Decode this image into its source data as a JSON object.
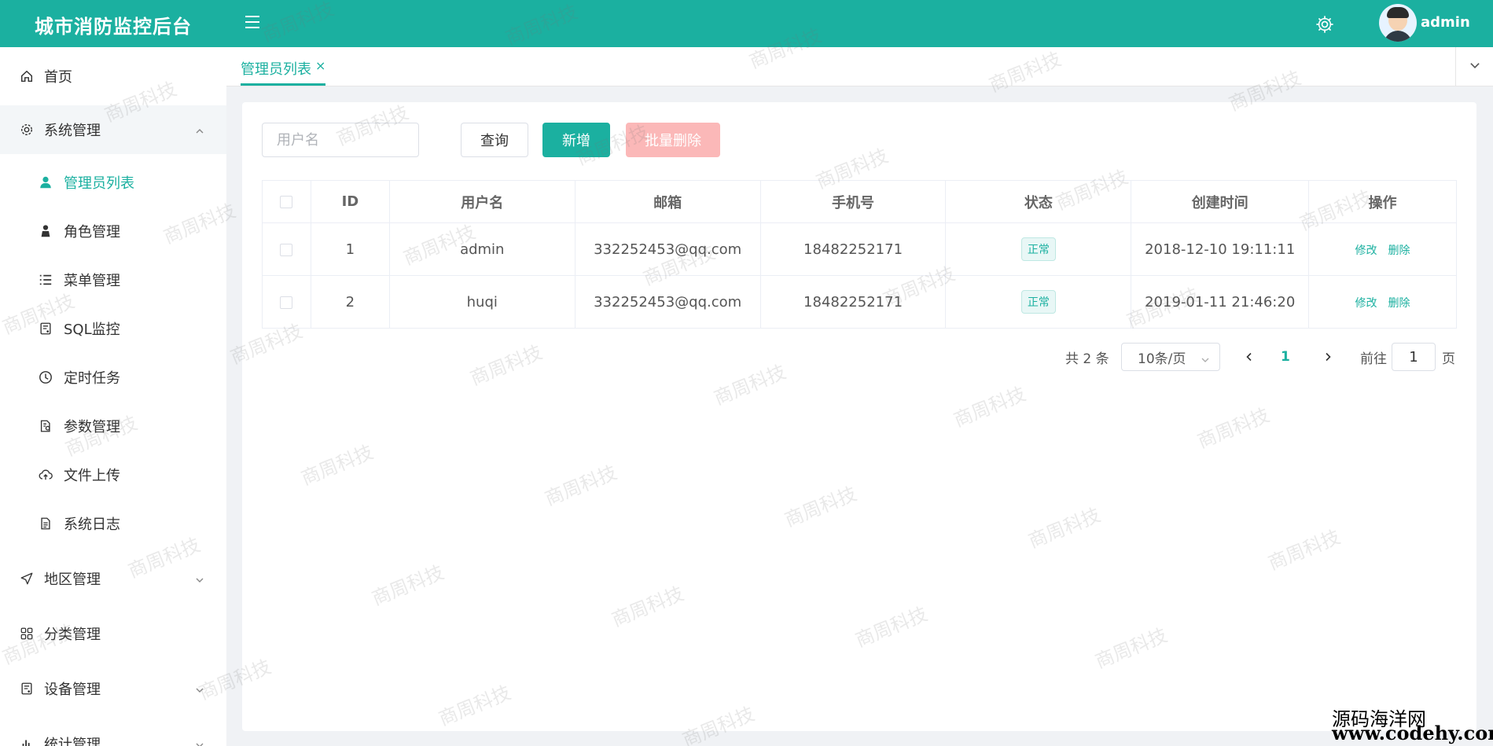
{
  "app": {
    "title": "城市消防监控后台",
    "username": "admin"
  },
  "colors": {
    "primary": "#1bb0a0",
    "danger_light": "#fbb8b8"
  },
  "sidebar": {
    "items": [
      {
        "label": "首页",
        "icon": "home-icon"
      },
      {
        "label": "系统管理",
        "icon": "gear-icon",
        "expanded": true
      },
      {
        "label": "管理员列表",
        "icon": "user-icon",
        "active": true
      },
      {
        "label": "角色管理",
        "icon": "role-icon"
      },
      {
        "label": "菜单管理",
        "icon": "list-icon"
      },
      {
        "label": "SQL监控",
        "icon": "database-icon"
      },
      {
        "label": "定时任务",
        "icon": "clock-icon"
      },
      {
        "label": "参数管理",
        "icon": "settings-doc-icon"
      },
      {
        "label": "文件上传",
        "icon": "cloud-upload-icon"
      },
      {
        "label": "系统日志",
        "icon": "document-icon"
      },
      {
        "label": "地区管理",
        "icon": "location-icon"
      },
      {
        "label": "分类管理",
        "icon": "grid-icon"
      },
      {
        "label": "设备管理",
        "icon": "device-icon"
      },
      {
        "label": "统计管理",
        "icon": "chart-icon"
      }
    ]
  },
  "tabs": [
    {
      "label": "管理员列表",
      "close": "×"
    }
  ],
  "toolbar": {
    "search_placeholder": "用户名",
    "query_label": "查询",
    "add_label": "新增",
    "batch_delete_label": "批量删除"
  },
  "table": {
    "headers": [
      "ID",
      "用户名",
      "邮箱",
      "手机号",
      "状态",
      "创建时间",
      "操作"
    ],
    "rows": [
      {
        "id": "1",
        "username": "admin",
        "email": "332252453@qq.com",
        "phone": "18482252171",
        "status": "正常",
        "created": "2018-12-10 19:11:11",
        "edit": "修改",
        "delete": "删除"
      },
      {
        "id": "2",
        "username": "huqi",
        "email": "332252453@qq.com",
        "phone": "18482252171",
        "status": "正常",
        "created": "2019-01-11 21:46:20",
        "edit": "修改",
        "delete": "删除"
      }
    ]
  },
  "pagination": {
    "total_text": "共 2 条",
    "page_size": "10条/页",
    "current_page": "1",
    "goto_label": "前往",
    "goto_value": "1",
    "page_unit": "页"
  },
  "watermark": {
    "text": "商周科技"
  },
  "footer_badge": {
    "name": "源码海洋网",
    "url": "www.codehy.com"
  }
}
